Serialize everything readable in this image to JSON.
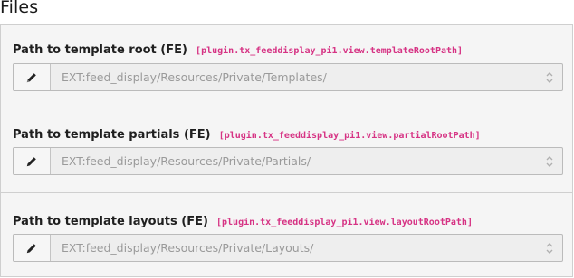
{
  "page": {
    "heading": "Files"
  },
  "fields": [
    {
      "label": "Path to template root (FE)",
      "typoscript_path": "[plugin.tx_feeddisplay_pi1.view.templateRootPath]",
      "value": "EXT:feed_display/Resources/Private/Templates/"
    },
    {
      "label": "Path to template partials (FE)",
      "typoscript_path": "[plugin.tx_feeddisplay_pi1.view.partialRootPath]",
      "value": "EXT:feed_display/Resources/Private/Partials/"
    },
    {
      "label": "Path to template layouts (FE)",
      "typoscript_path": "[plugin.tx_feeddisplay_pi1.view.layoutRootPath]",
      "value": "EXT:feed_display/Resources/Private/Layouts/"
    }
  ],
  "icons": {
    "edit": "pencil-icon",
    "select": "chevron-up-down-icon"
  },
  "colors": {
    "panel_background": "#f5f5f5",
    "field_background": "#eeeeee",
    "typoscript_path": "#d63384",
    "value_text": "#9a9a9a"
  }
}
